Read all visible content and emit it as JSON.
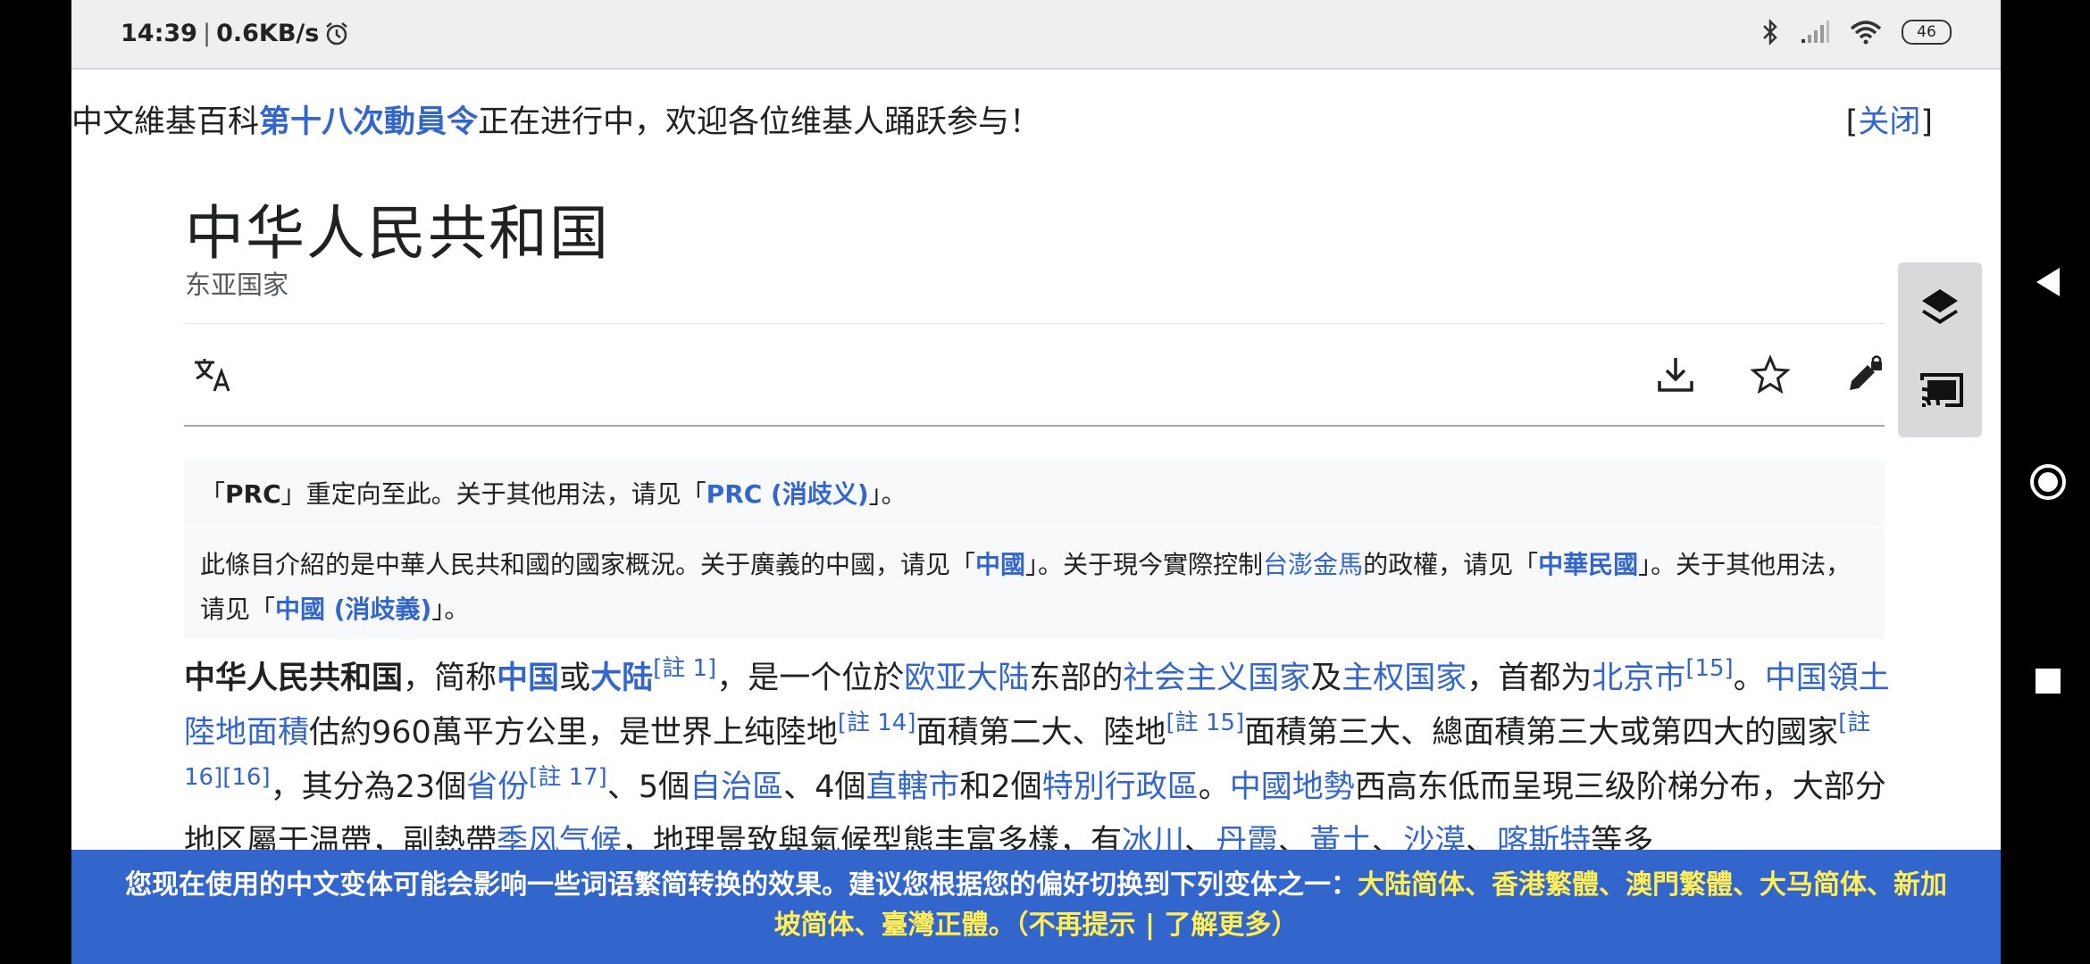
{
  "status_bar": {
    "time": "14:39",
    "separator": "|",
    "speed": "0.6KB/s",
    "battery": "46",
    "icons": [
      "alarm-icon",
      "bluetooth-icon",
      "signal-icon",
      "wifi-icon",
      "battery-icon"
    ]
  },
  "banner": {
    "prefix": "中文維基百科",
    "link": "第十八次動員令",
    "suffix": "正在进行中，欢迎各位维基人踊跃参与！",
    "close_open": "[",
    "close_label": "关闭",
    "close_close": "]"
  },
  "page": {
    "title": "中华人民共和国",
    "subtitle": "东亚国家"
  },
  "hatnote1": {
    "t1": "「",
    "b1": "PRC",
    "t2": "」重定向至此。关于其他用法，请见「",
    "l1": "PRC (消歧义)",
    "t3": "」。"
  },
  "hatnote2": {
    "t1": "此條目介紹的是中華人民共和國的國家概況。关于廣義的中國，请见「",
    "l1": "中國",
    "t2": "」。关于現今實際控制",
    "l2": "台澎金馬",
    "t3": "的政權，请见「",
    "l3": "中華民國",
    "t4": "」。关于其他用法，请见「",
    "l4": "中國 (消歧義)",
    "t5": "」。"
  },
  "article": {
    "lead": "中华人民共和国",
    "s1": "，简称",
    "l_china": "中国",
    "s2": "或",
    "l_mainland": "大陆",
    "n1": "[註 1]",
    "s3": "，是一个位於",
    "l_eurasia": "欧亚大陆",
    "s4": "东部的",
    "l_socialist": "社会主义国家",
    "s5": "及",
    "l_sovereign": "主权国家",
    "s6": "，首都为",
    "l_beijing": "北京市",
    "n2": "[15]",
    "s7": "。",
    "l_area": "中国領土陸地面積",
    "s8": "估約960萬平方公里，是世界上纯陸地",
    "n3": "[註 14]",
    "s9": "面積第二大、陸地",
    "n4": "[註 15]",
    "s10": "面積第三大、總面積第三大或第四大的國家",
    "n5": "[註 16][16]",
    "s11": "，其分為23個",
    "l_province": "省份",
    "n6": "[註 17]",
    "s12": "、5個",
    "l_autonomous": "自治區",
    "s13": "、4個",
    "l_municipality": "直轄市",
    "s14": "和2個",
    "l_sar": "特別行政區",
    "s15": "。",
    "l_terrain": "中國地勢",
    "s16": "西高东低而呈現三级阶梯分布，大部分地区屬于温帶，副熱帶",
    "l_monsoon": "季风气候",
    "s17": "，地理景致與氣候型態丰富多樣，有",
    "l_glacier": "冰川",
    "s18": "、",
    "l_danxia": "丹霞",
    "s19": "、",
    "l_loess": "黃土",
    "s20": "、",
    "l_desert": "沙漠",
    "s21": "、",
    "l_karst": "喀斯特",
    "s22": "等多"
  },
  "notice": {
    "text": "您现在使用的中文变体可能会影响一些词语繁简转换的效果。建议您根据您的偏好切换到下列变体之一：",
    "v1": "大陆简体",
    "sep1": "、",
    "v2": "香港繁體",
    "sep2": "、",
    "v3": "澳門繁體",
    "sep3": "、",
    "v4": "大马简体",
    "sep4": "、",
    "v5": "新加坡简体",
    "sep5": "、",
    "v6": "臺灣正體",
    "mid": "。（",
    "dismiss": "不再提示",
    "pipe": " | ",
    "learn": "了解更多",
    "end": "）"
  },
  "colors": {
    "link": "#3366cc",
    "notice_bg": "#3366cc",
    "notice_highlight": "#ffee55",
    "text": "#202122"
  }
}
